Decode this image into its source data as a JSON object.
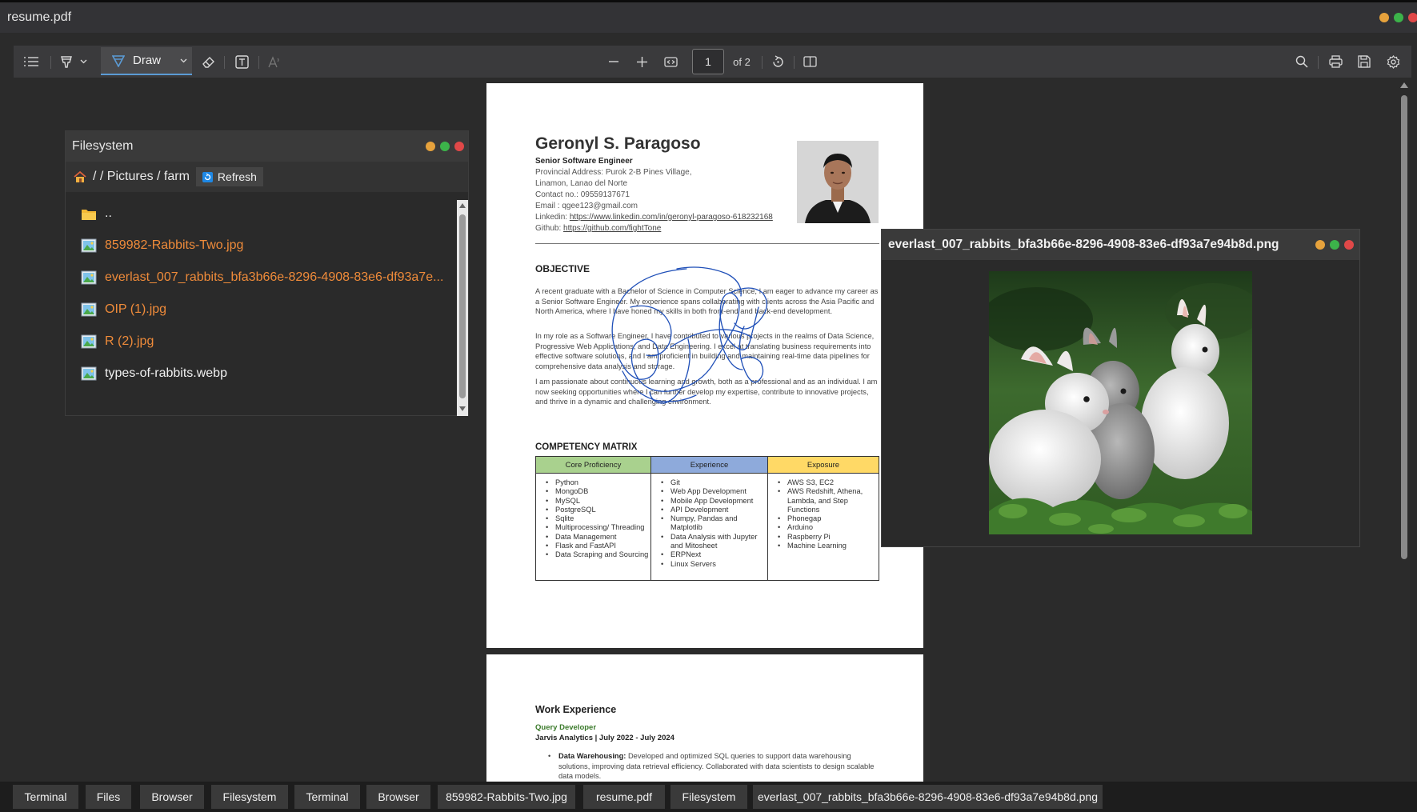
{
  "window": {
    "title": "resume.pdf",
    "dot_colors": [
      "#e6a23c",
      "#3cb34a",
      "#e04848"
    ]
  },
  "toolbar": {
    "draw_label": "Draw",
    "page_number": "1",
    "page_total": "of 2",
    "accent": "#5b9bd5"
  },
  "resume": {
    "name": "Geronyl S. Paragoso",
    "role": "Senior Software Engineer",
    "address1": "Provincial Address: Purok 2-B Pines Village,",
    "address2": "Linamon, Lanao del Norte",
    "contact": "Contact no.: 09559137671",
    "email": "Email : qgee123@gmail.com",
    "linkedin_label": "Linkedin: ",
    "linkedin_url": "https://www.linkedin.com/in/geronyl-paragoso-618232168",
    "github_label": "Github: ",
    "github_url": "https://github.com/fightTone",
    "objective_heading": "OBJECTIVE",
    "objective_p1": "A recent graduate with a Bachelor of Science in Computer Science, I am eager to advance my career as a Senior Software Engineer. My experience spans collaborating with clients across the Asia Pacific and North America, where I have honed my skills in both front-end and back-end development.",
    "objective_p2": "In my role as a Software Engineer, I have contributed to various projects in the realms of Data Science, Progressive Web Applications, and Data Engineering. I excel at translating business requirements into effective software solutions, and I am proficient in building and maintaining real-time data pipelines for comprehensive data analysis and storage.",
    "objective_p3": "I am passionate about continuous learning and growth, both as a professional and as an individual. I am now seeking opportunities where I can further develop my expertise, contribute to innovative projects, and thrive in a dynamic and challenging environment.",
    "matrix_heading": "COMPETENCY MATRIX",
    "matrix": [
      {
        "header": "Core Proficiency",
        "color": "#a9d18e",
        "items": [
          "Python",
          "MongoDB",
          "MySQL",
          "PostgreSQL",
          "Sqlite",
          "Multiprocessing/ Threading",
          "Data Management",
          "Flask and FastAPI",
          "Data Scraping and Sourcing"
        ]
      },
      {
        "header": "Experience",
        "color": "#8eaadb",
        "items": [
          "Git",
          "Web App Development",
          "Mobile App Development",
          "API Development",
          "Numpy, Pandas and Matplotlib",
          "Data Analysis with Jupyter and Mitosheet",
          "ERPNext",
          "Linux Servers"
        ]
      },
      {
        "header": "Exposure",
        "color": "#ffd966",
        "items": [
          "AWS S3, EC2",
          "AWS Redshift, Athena, Lambda, and Step Functions",
          "Phonegap",
          "Arduino",
          "Raspberry Pi",
          "Machine Learning"
        ]
      }
    ],
    "work_heading": "Work Experience",
    "job_title": "Query Developer",
    "job_company": "Jarvis Analytics | July 2022 - July 2024",
    "job_bullet_label": "Data Warehousing:",
    "job_bullet_text": " Developed and optimized SQL queries to support data warehousing solutions, improving data retrieval efficiency. Collaborated with data scientists to design scalable data models."
  },
  "filesystem": {
    "title": "Filesystem",
    "path": "/ / Pictures / farm",
    "refresh_label": "Refresh",
    "items": [
      {
        "name": "..",
        "type": "folder"
      },
      {
        "name": "859982-Rabbits-Two.jpg",
        "type": "image"
      },
      {
        "name": "everlast_007_rabbits_bfa3b66e-8296-4908-83e6-df93a7e...",
        "type": "image"
      },
      {
        "name": "OIP (1).jpg",
        "type": "image"
      },
      {
        "name": "R (2).jpg",
        "type": "image"
      },
      {
        "name": "types-of-rabbits.webp",
        "type": "image"
      }
    ]
  },
  "image_viewer": {
    "title": "everlast_007_rabbits_bfa3b66e-8296-4908-83e6-df93a7e94b8d.png"
  },
  "taskbar": {
    "items": [
      "Terminal",
      "Files",
      "Browser",
      "Filesystem",
      "Terminal",
      "Browser",
      "859982-Rabbits-Two.jpg",
      "resume.pdf",
      "Filesystem",
      "everlast_007_rabbits_bfa3b66e-8296-4908-83e6-df93a7e94b8d.png"
    ]
  }
}
